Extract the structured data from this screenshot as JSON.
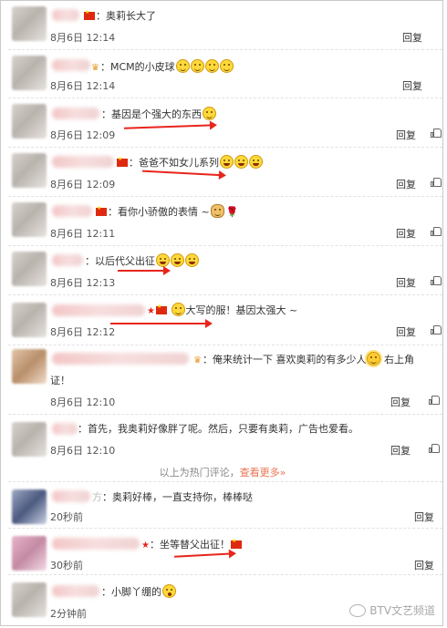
{
  "comments": [
    {
      "text": "：奥莉长大了",
      "time": "8月6日 12:14",
      "reply": "回复"
    },
    {
      "text": "：MCM的小皮球",
      "time": "8月6日 12:14",
      "reply": "回复"
    },
    {
      "text": "：基因是个强大的东西",
      "time": "8月6日 12:09",
      "reply": "回复"
    },
    {
      "text": "：爸爸不如女儿系列",
      "time": "8月6日 12:09",
      "reply": "回复"
    },
    {
      "text": "：看你小骄傲的表情 ~",
      "time": "8月6日 12:11",
      "reply": "回复"
    },
    {
      "text": "：以后代父出征",
      "time": "8月6日 12:13",
      "reply": "回复"
    },
    {
      "text": "大写的服！基因太强大 ~",
      "time": "8月6日 12:12",
      "reply": "回复"
    },
    {
      "text": "：俺来统计一下  喜欢奥莉的有多少人",
      "text_end": "右上角",
      "text2": "证！",
      "time": "8月6日 12:10",
      "reply": "回复"
    },
    {
      "text": "：首先，我奥莉好像胖了呢。然后，只要有奥莉，广告也爱看。",
      "time": "8月6日 12:10",
      "reply": "回复"
    }
  ],
  "hot_divider": {
    "text": "以上为热门评论，",
    "link": "查看更多»"
  },
  "recent": [
    {
      "name_tail": "方",
      "text": "：奥莉好棒，一直支持你，棒棒哒",
      "time": "20秒前",
      "reply": "回复"
    },
    {
      "text": "：坐等替父出征！",
      "time": "30秒前",
      "reply": "回复"
    },
    {
      "text": "：小脚丫绷的",
      "time": "2分钟前",
      "reply": "回复"
    }
  ],
  "watermark": "BTV文艺频道"
}
